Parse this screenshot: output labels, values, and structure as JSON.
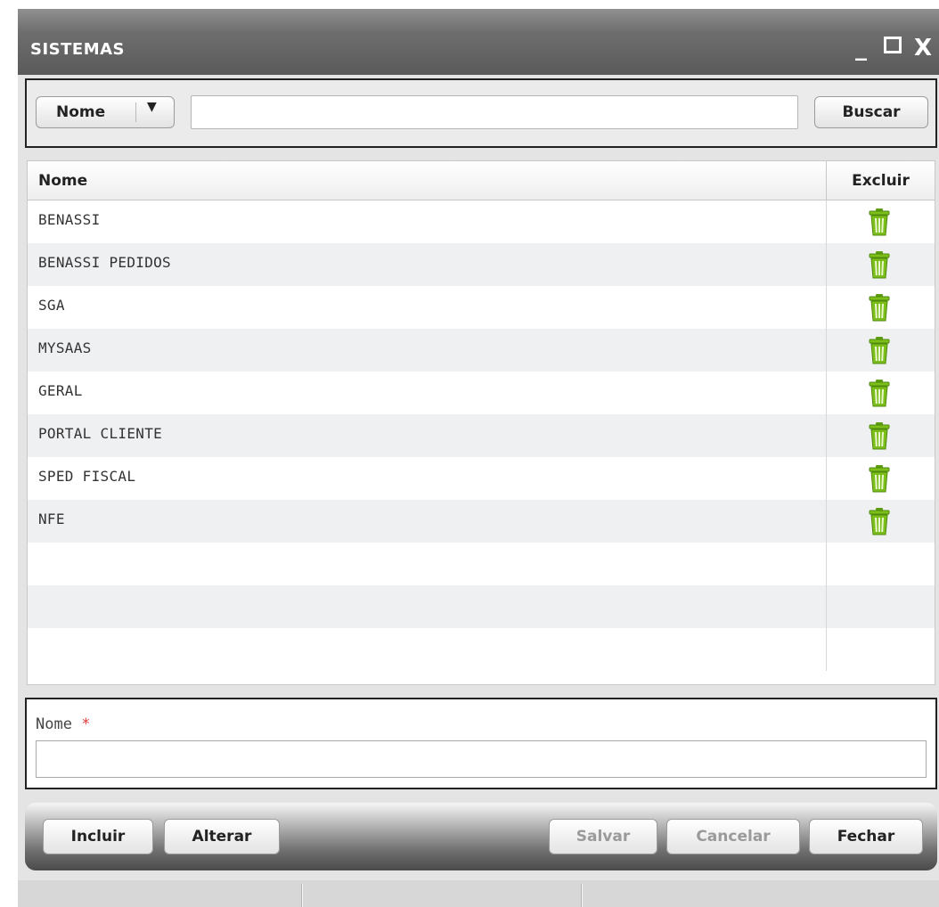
{
  "window": {
    "title": "SISTEMAS",
    "controls": {
      "minimize": "_",
      "close": "X"
    }
  },
  "search": {
    "field_selected": "Nome",
    "caret": "▼",
    "query_value": "",
    "button_label": "Buscar"
  },
  "grid": {
    "columns": {
      "name": "Nome",
      "delete": "Excluir"
    },
    "rows": [
      {
        "name": "BENASSI"
      },
      {
        "name": "BENASSI PEDIDOS"
      },
      {
        "name": "SGA"
      },
      {
        "name": "MYSAAS"
      },
      {
        "name": "GERAL"
      },
      {
        "name": "PORTAL CLIENTE"
      },
      {
        "name": "SPED FISCAL"
      },
      {
        "name": "NFE"
      },
      {
        "name": ""
      },
      {
        "name": ""
      },
      {
        "name": ""
      }
    ],
    "delete_icon": "trash-icon",
    "delete_icon_color": "#7cbf1a"
  },
  "form": {
    "label": "Nome",
    "required_marker": "*",
    "value": ""
  },
  "toolbar": {
    "incluir": "Incluir",
    "alterar": "Alterar",
    "salvar": "Salvar",
    "cancelar": "Cancelar",
    "fechar": "Fechar"
  }
}
